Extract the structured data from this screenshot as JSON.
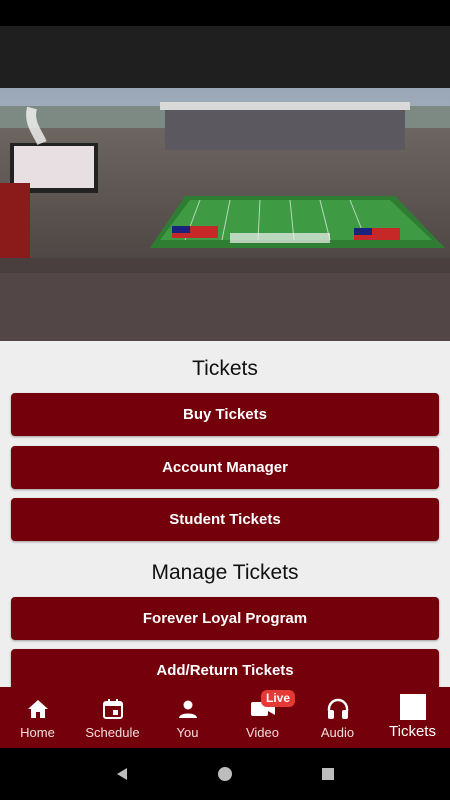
{
  "hero": {
    "image": "stadium-photo",
    "description_icon": "stadium-image"
  },
  "tickets_section": {
    "title": "Tickets",
    "buttons": [
      "Buy Tickets",
      "Account Manager",
      "Student Tickets"
    ]
  },
  "manage_section": {
    "title": "Manage Tickets",
    "buttons": [
      "Forever Loyal Program",
      "Add/Return Tickets"
    ]
  },
  "tabbar": {
    "tabs": [
      {
        "label": "Home",
        "icon": "home-icon"
      },
      {
        "label": "Schedule",
        "icon": "calendar-icon"
      },
      {
        "label": "You",
        "icon": "person-icon"
      },
      {
        "label": "Video",
        "icon": "video-icon",
        "badge": "Live"
      },
      {
        "label": "Audio",
        "icon": "headphones-icon"
      },
      {
        "label": "Tickets",
        "icon": "tickets-icon",
        "active": true
      }
    ]
  },
  "colors": {
    "brand": "#73000a",
    "background": "#eeeeee",
    "badge": "#e53935"
  }
}
